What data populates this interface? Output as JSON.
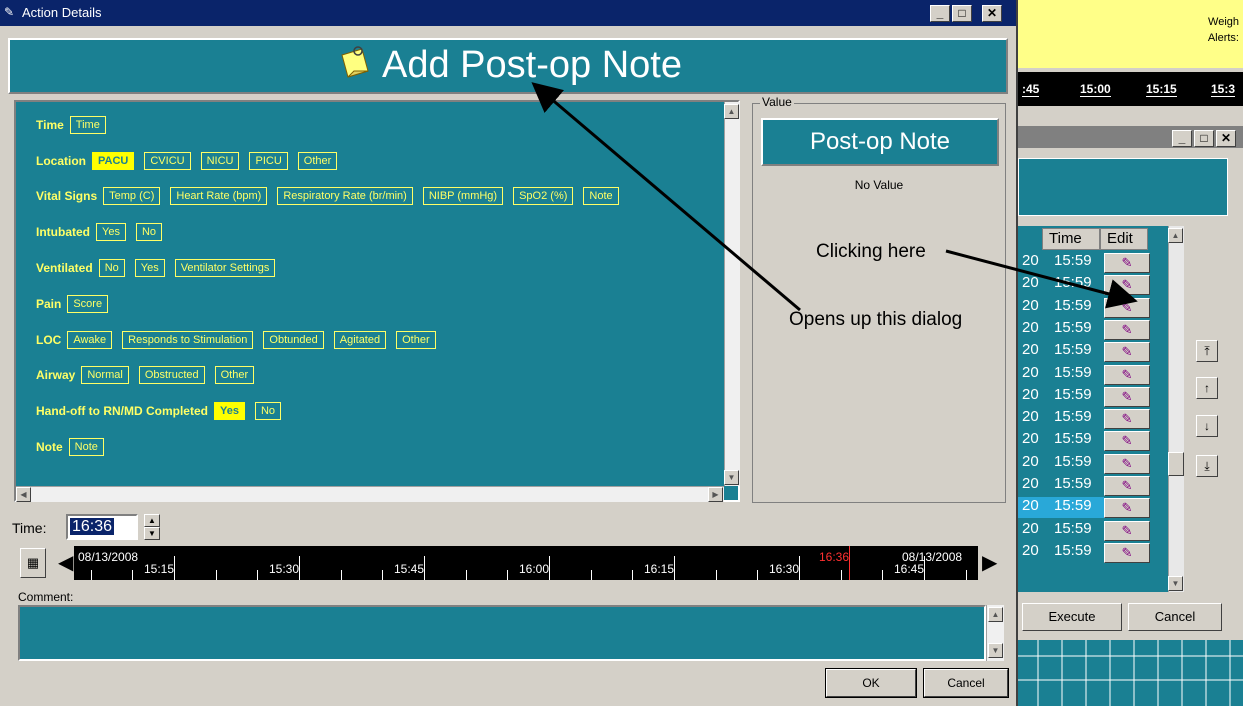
{
  "dialog": {
    "title": "Action Details",
    "header_title": "Add Post-op Note",
    "minimize_label": "_",
    "maximize_label": "□",
    "close_label": "✕"
  },
  "form": {
    "rows": [
      {
        "label": "Time",
        "options": [
          "Time"
        ],
        "selected": []
      },
      {
        "label": "Location",
        "options": [
          "PACU",
          "CVICU",
          "NICU",
          "PICU",
          "Other"
        ],
        "selected": [
          "PACU"
        ]
      },
      {
        "label": "Vital Signs",
        "options": [
          "Temp (C)",
          "Heart Rate (bpm)",
          "Respiratory Rate (br/min)",
          "NIBP (mmHg)",
          "SpO2 (%)",
          "Note"
        ],
        "selected": []
      },
      {
        "label": "Intubated",
        "options": [
          "Yes",
          "No"
        ],
        "selected": []
      },
      {
        "label": "Ventilated",
        "options": [
          "No",
          "Yes",
          "Ventilator Settings"
        ],
        "selected": []
      },
      {
        "label": "Pain",
        "options": [
          "Score"
        ],
        "selected": []
      },
      {
        "label": "LOC",
        "options": [
          "Awake",
          "Responds to Stimulation",
          "Obtunded",
          "Agitated",
          "Other"
        ],
        "selected": []
      },
      {
        "label": "Airway",
        "options": [
          "Normal",
          "Obstructed",
          "Other"
        ],
        "selected": []
      },
      {
        "label": "Hand-off to RN/MD Completed",
        "options": [
          "Yes",
          "No"
        ],
        "selected": [
          "Yes"
        ]
      },
      {
        "label": "Note",
        "options": [
          "Note"
        ],
        "selected": []
      }
    ]
  },
  "value": {
    "legend": "Value",
    "box_label": "Post-op Note",
    "no_value": "No Value"
  },
  "time": {
    "label": "Time:",
    "value": "16:36"
  },
  "timeline": {
    "start_date": "08/13/2008",
    "end_date": "08/13/2008",
    "ticks": [
      "15:15",
      "15:30",
      "15:45",
      "16:00",
      "16:15",
      "16:30",
      "16:45"
    ],
    "current": "16:36",
    "current_color": "#ff3030"
  },
  "comment": {
    "label": "Comment:"
  },
  "buttons": {
    "ok": "OK",
    "cancel": "Cancel"
  },
  "background_window": {
    "weigh": "Weigh",
    "alerts": "Alerts:",
    "times": [
      ":45",
      "15:00",
      "15:15",
      "15:3"
    ],
    "list_headers": [
      "Time",
      "Edit"
    ],
    "rows_time": [
      "15:59",
      "15:59",
      "15:59",
      "15:59",
      "15:59",
      "15:59",
      "15:59",
      "15:59",
      "15:59",
      "15:59",
      "15:59",
      "15:59",
      "15:59",
      "15:59"
    ],
    "row_prefix": "20",
    "execute": "Execute",
    "cancel": "Cancel"
  },
  "annotations": {
    "clicking_here": "Clicking here",
    "opens_dialog": "Opens up this dialog"
  },
  "colors": {
    "teal": "#1a8093",
    "label_yellow": "#ffff66",
    "title_blue": "#0a246a"
  }
}
